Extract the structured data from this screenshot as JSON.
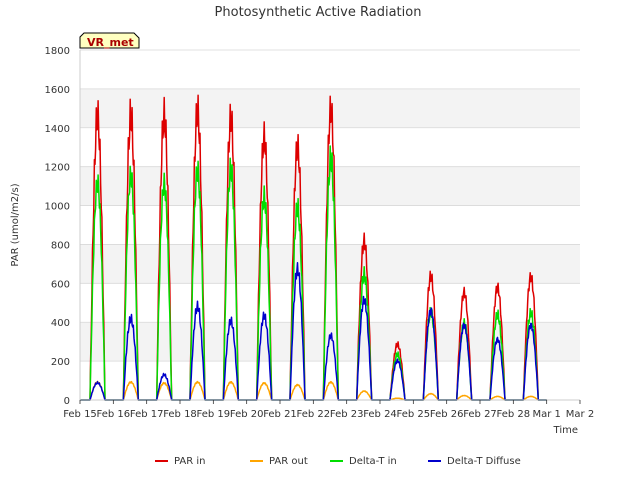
{
  "chart_data": {
    "type": "line",
    "title": "Photosynthetic Active Radiation",
    "xlabel": "Time",
    "ylabel": "PAR (umol/m2/s)",
    "ylim": [
      0,
      1800
    ],
    "yticks": [
      0,
      200,
      400,
      600,
      800,
      1000,
      1200,
      1400,
      1600,
      1800
    ],
    "xlim": [
      0,
      15
    ],
    "xticks": [
      0,
      1,
      2,
      3,
      4,
      5,
      6,
      7,
      8,
      9,
      10,
      11,
      12,
      13,
      14,
      15
    ],
    "xtick_labels": [
      "Feb 15",
      "Feb 16",
      "Feb 17",
      "Feb 18",
      "Feb 19",
      "Feb 20",
      "Feb 21",
      "Feb 22",
      "Feb 23",
      "Feb 24",
      "Feb 25",
      "Feb 26",
      "Feb 27",
      "Feb 28",
      "Mar 1",
      "Mar 2"
    ],
    "grid": true,
    "background_bands": true,
    "legend_position": "bottom",
    "annotation": "VR_met",
    "series": [
      {
        "name": "PAR in",
        "color": "#dd0000",
        "day_peaks": [
          1560,
          1560,
          1560,
          1590,
          1550,
          1450,
          1400,
          1610,
          880,
          310,
          690,
          600,
          630,
          690
        ]
      },
      {
        "name": "PAR out",
        "color": "#ffa500",
        "day_peaks": [
          100,
          100,
          95,
          100,
          100,
          95,
          85,
          100,
          50,
          10,
          35,
          25,
          20,
          20
        ]
      },
      {
        "name": "Delta-T in",
        "color": "#00dd00",
        "day_peaks": [
          1210,
          1250,
          1200,
          1270,
          1280,
          1120,
          1060,
          1330,
          690,
          250,
          480,
          420,
          470,
          480
        ]
      },
      {
        "name": "Delta-T Diffuse",
        "color": "#0000cc",
        "day_peaks": [
          95,
          450,
          140,
          520,
          440,
          470,
          730,
          360,
          560,
          220,
          500,
          420,
          340,
          420
        ]
      }
    ]
  }
}
